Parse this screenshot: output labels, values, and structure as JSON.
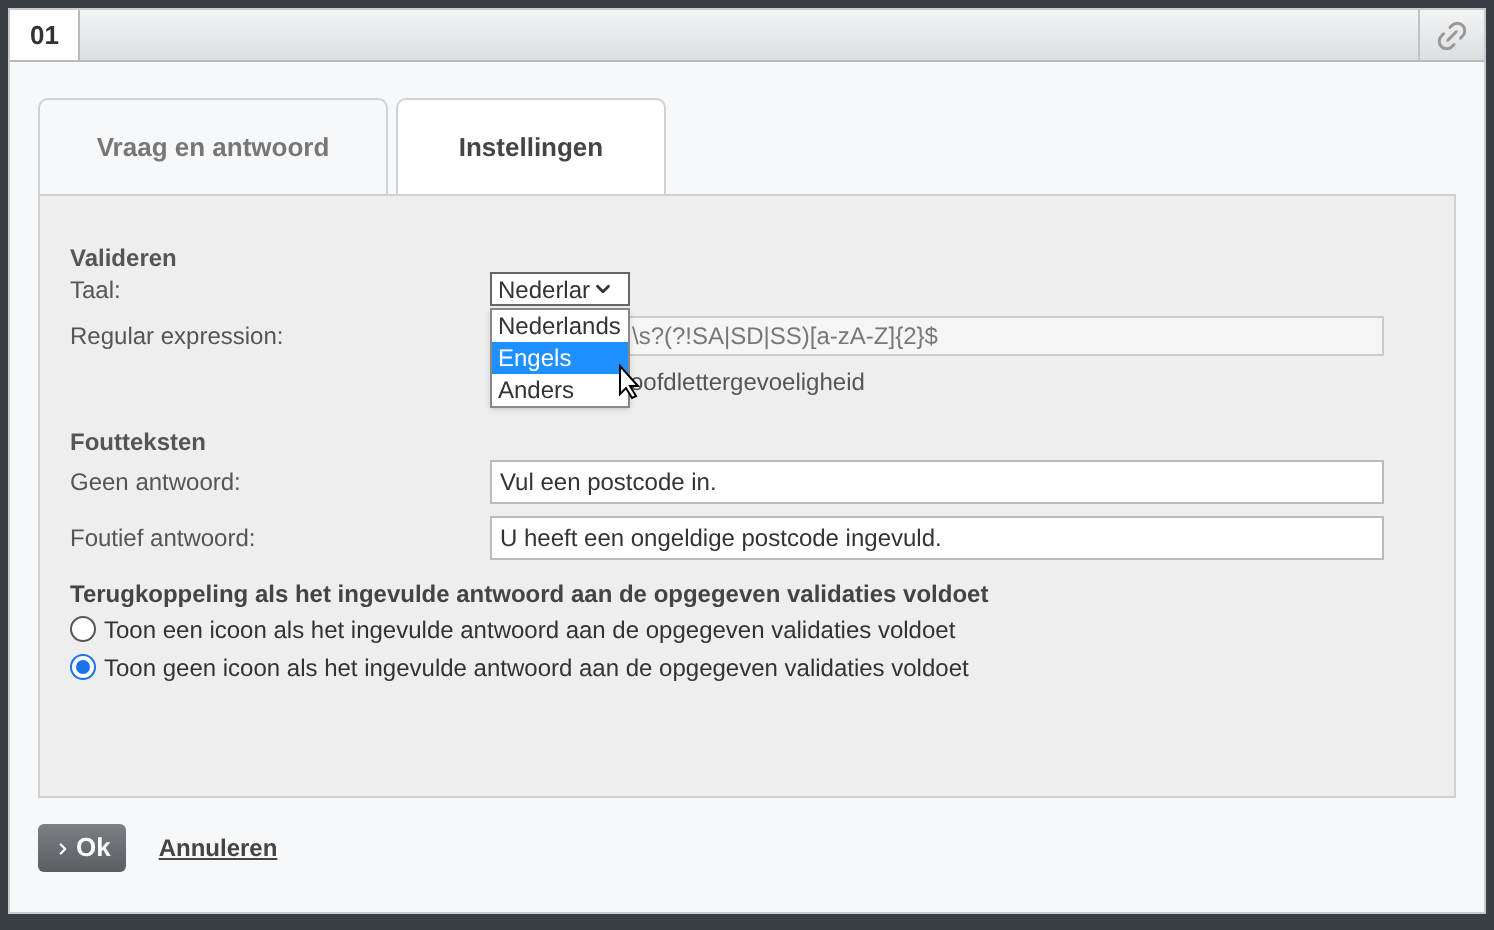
{
  "window": {
    "title": "01"
  },
  "tabs": [
    {
      "label": "Vraag en antwoord",
      "selected": false
    },
    {
      "label": "Instellingen",
      "selected": true
    }
  ],
  "validate": {
    "heading": "Valideren",
    "language_label": "Taal:",
    "language_value": "Nederlar",
    "regex_label": "Regular expression:",
    "regex_value": "\\s?(?!SA|SD|SS)[a-zA-Z]{2}$",
    "case_label": "oofdlettergevoeligheid",
    "options": [
      {
        "label": "Nederlands",
        "selected": false
      },
      {
        "label": "Engels",
        "selected": true
      },
      {
        "label": "Anders",
        "selected": false
      }
    ]
  },
  "errors": {
    "heading": "Foutteksten",
    "fields": [
      {
        "label": "Geen antwoord:",
        "value": "Vul een postcode in."
      },
      {
        "label": "Foutief antwoord:",
        "value": "U heeft een ongeldige postcode ingevuld."
      }
    ]
  },
  "feedback": {
    "heading": "Terugkoppeling als het ingevulde antwoord aan de opgegeven validaties voldoet",
    "options": [
      {
        "label": "Toon een icoon als het ingevulde antwoord aan de opgegeven validaties voldoet",
        "selected": false
      },
      {
        "label": "Toon geen icoon als het ingevulde antwoord aan de opgegeven validaties voldoet",
        "selected": true
      }
    ]
  },
  "buttons": {
    "ok": "Ok",
    "cancel": "Annuleren"
  }
}
